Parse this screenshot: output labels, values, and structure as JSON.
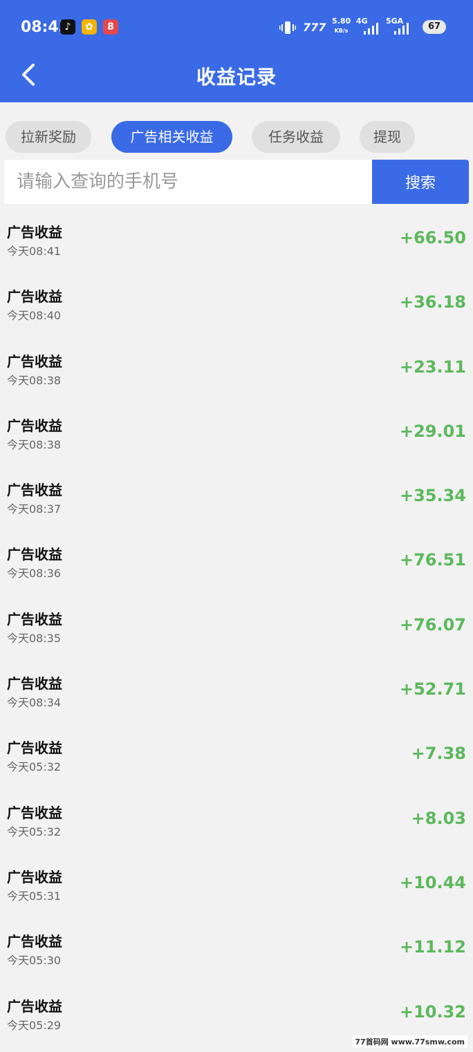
{
  "status_bar": {
    "time": "08:43",
    "net_speed": "5.80",
    "net_unit": "KB/s",
    "network_1": "4G",
    "network_2": "5GA",
    "battery": "67"
  },
  "header": {
    "title": "收益记录"
  },
  "tabs": [
    {
      "label": "拉新奖励",
      "active": false
    },
    {
      "label": "广告相关收益",
      "active": true
    },
    {
      "label": "任务收益",
      "active": false
    },
    {
      "label": "提现",
      "active": false
    }
  ],
  "search": {
    "placeholder": "请输入查询的手机号",
    "button_label": "搜索"
  },
  "records": [
    {
      "title": "广告收益",
      "time": "今天08:41",
      "amount": "+66.50"
    },
    {
      "title": "广告收益",
      "time": "今天08:40",
      "amount": "+36.18"
    },
    {
      "title": "广告收益",
      "time": "今天08:38",
      "amount": "+23.11"
    },
    {
      "title": "广告收益",
      "time": "今天08:38",
      "amount": "+29.01"
    },
    {
      "title": "广告收益",
      "time": "今天08:37",
      "amount": "+35.34"
    },
    {
      "title": "广告收益",
      "time": "今天08:36",
      "amount": "+76.51"
    },
    {
      "title": "广告收益",
      "time": "今天08:35",
      "amount": "+76.07"
    },
    {
      "title": "广告收益",
      "time": "今天08:34",
      "amount": "+52.71"
    },
    {
      "title": "广告收益",
      "time": "今天05:32",
      "amount": "+7.38"
    },
    {
      "title": "广告收益",
      "time": "今天05:32",
      "amount": "+8.03"
    },
    {
      "title": "广告收益",
      "time": "今天05:31",
      "amount": "+10.44"
    },
    {
      "title": "广告收益",
      "time": "今天05:30",
      "amount": "+11.12"
    },
    {
      "title": "广告收益",
      "time": "今天05:29",
      "amount": "+10.32"
    }
  ],
  "watermark": "77首码网 www.77smw.com",
  "colors": {
    "primary": "#3a6ae6",
    "amount_green": "#5cb85c",
    "background": "#f2f2f2"
  }
}
